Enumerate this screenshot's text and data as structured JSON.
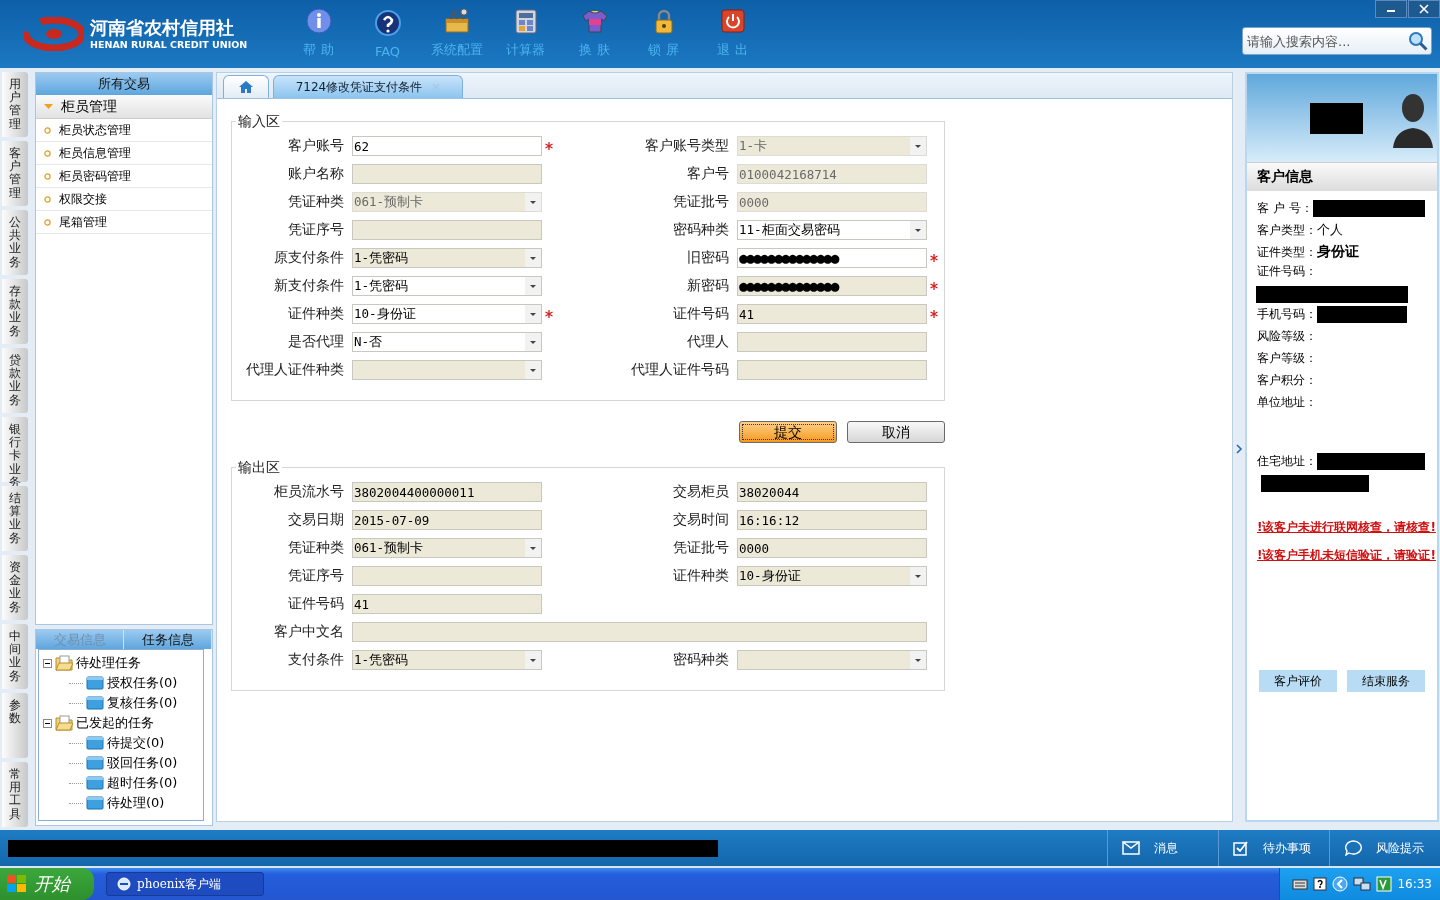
{
  "app": {
    "logo_title": "河南省农村信用社",
    "logo_subtitle": "HENAN RURAL CREDIT UNION"
  },
  "toolbar": [
    {
      "label": "帮 助",
      "kind": "help"
    },
    {
      "label": "FAQ",
      "kind": "faq"
    },
    {
      "label": "系统配置",
      "kind": "config"
    },
    {
      "label": "计算器",
      "kind": "calculator"
    },
    {
      "label": "换 肤",
      "kind": "skin"
    },
    {
      "label": "锁 屏",
      "kind": "lock"
    },
    {
      "label": "退 出",
      "kind": "exit"
    }
  ],
  "search": {
    "placeholder": "请输入搜索内容..."
  },
  "side_tabs": [
    {
      "label": "用户管理"
    },
    {
      "label": "客户管理"
    },
    {
      "label": "公共业务"
    },
    {
      "label": "存款业务"
    },
    {
      "label": "贷款业务"
    },
    {
      "label": "银行卡业务"
    },
    {
      "label": "结算业务"
    },
    {
      "label": "资金业务"
    },
    {
      "label": "中间业务"
    },
    {
      "label": "参数"
    },
    {
      "label": "常用工具"
    }
  ],
  "nav": {
    "title": "所有交易",
    "group": {
      "label": "柜员管理",
      "expanded": true,
      "items": [
        {
          "label": "柜员状态管理"
        },
        {
          "label": "柜员信息管理"
        },
        {
          "label": "柜员密码管理"
        },
        {
          "label": "权限交接"
        },
        {
          "label": "尾箱管理"
        }
      ]
    }
  },
  "task_panel": {
    "tabs": [
      {
        "label": "交易信息",
        "selected": false
      },
      {
        "label": "任务信息",
        "selected": true
      }
    ],
    "tree": [
      {
        "label": "待处理任务",
        "expanded": true,
        "children": [
          {
            "label": "授权任务(0)"
          },
          {
            "label": "复核任务(0)"
          }
        ]
      },
      {
        "label": "已发起的任务",
        "expanded": true,
        "children": [
          {
            "label": "待提交(0)"
          },
          {
            "label": "驳回任务(0)"
          },
          {
            "label": "超时任务(0)"
          },
          {
            "label": "待处理(0)"
          }
        ]
      }
    ]
  },
  "tabs": [
    {
      "kind": "home",
      "selected": false
    },
    {
      "kind": "page",
      "label": "7124修改凭证支付条件",
      "selected": true,
      "closable": true
    }
  ],
  "input_section": {
    "title": "输入区",
    "fields": [
      {
        "label": "客户账号",
        "value": "62",
        "kind": "text",
        "editable": true,
        "disabled": false,
        "required": true
      },
      {
        "label": "客户账号类型",
        "value": "1-卡",
        "kind": "select",
        "editable": false,
        "disabled": true,
        "required": false
      },
      {
        "label": "账户名称",
        "kind": "text",
        "editable": false,
        "disabled": false,
        "required": false
      },
      {
        "label": "客户号",
        "value": "0100042168714",
        "kind": "text",
        "editable": false,
        "disabled": true,
        "required": false
      },
      {
        "label": "凭证种类",
        "value": "061-预制卡",
        "kind": "select",
        "editable": false,
        "disabled": true,
        "required": false
      },
      {
        "label": "凭证批号",
        "value": "0000",
        "kind": "text",
        "editable": false,
        "disabled": true,
        "required": false
      },
      {
        "label": "凭证序号",
        "kind": "text",
        "editable": false,
        "disabled": false,
        "required": false
      },
      {
        "label": "密码种类",
        "value": "11-柜面交易密码",
        "kind": "select",
        "editable": true,
        "disabled": false,
        "required": false
      },
      {
        "label": "原支付条件",
        "value": "1-凭密码",
        "kind": "select",
        "editable": false,
        "disabled": false,
        "required": false
      },
      {
        "label": "旧密码",
        "value": "●●●●●●●●●●●●●●",
        "kind": "password",
        "editable": true,
        "disabled": false,
        "required": true
      },
      {
        "label": "新支付条件",
        "value": "1-凭密码",
        "kind": "select",
        "editable": true,
        "disabled": false,
        "required": false
      },
      {
        "label": "新密码",
        "value": "●●●●●●●●●●●●●●",
        "kind": "password",
        "editable": false,
        "disabled": false,
        "required": true
      },
      {
        "label": "证件种类",
        "value": "10-身份证",
        "kind": "select",
        "editable": true,
        "disabled": false,
        "required": true
      },
      {
        "label": "证件号码",
        "value": "41",
        "kind": "text",
        "editable": false,
        "disabled": false,
        "required": true
      },
      {
        "label": "是否代理",
        "value": "N-否",
        "kind": "select",
        "editable": true,
        "disabled": false,
        "required": false
      },
      {
        "label": "代理人",
        "kind": "text",
        "editable": false,
        "disabled": false,
        "required": false
      },
      {
        "label": "代理人证件种类",
        "kind": "select",
        "editable": false,
        "disabled": false,
        "required": false
      },
      {
        "label": "代理人证件号码",
        "kind": "text",
        "editable": false,
        "disabled": false,
        "required": false
      }
    ]
  },
  "buttons": [
    {
      "label": "提交",
      "kind": "primary"
    },
    {
      "label": "取消",
      "kind": "normal"
    }
  ],
  "output_section": {
    "title": "输出区",
    "fields": [
      {
        "label": "柜员流水号",
        "value": "3802004400000011",
        "kind": "text",
        "editable": false,
        "disabled": false,
        "required": false
      },
      {
        "label": "交易柜员",
        "value": "38020044",
        "kind": "text",
        "editable": false,
        "disabled": false,
        "required": false
      },
      {
        "label": "交易日期",
        "value": "2015-07-09",
        "kind": "text",
        "editable": false,
        "disabled": false,
        "required": false
      },
      {
        "label": "交易时间",
        "value": "16:16:12",
        "kind": "text",
        "editable": false,
        "disabled": false,
        "required": false
      },
      {
        "label": "凭证种类",
        "value": "061-预制卡",
        "kind": "select",
        "editable": false,
        "disabled": false,
        "required": false
      },
      {
        "label": "凭证批号",
        "value": "0000",
        "kind": "text",
        "editable": false,
        "disabled": false,
        "required": false
      },
      {
        "label": "凭证序号",
        "kind": "text",
        "editable": false,
        "disabled": false,
        "required": false
      },
      {
        "label": "证件种类",
        "value": "10-身份证",
        "kind": "select",
        "editable": false,
        "disabled": false,
        "required": false
      },
      {
        "label": "证件号码",
        "value": "41",
        "kind": "text",
        "editable": false,
        "disabled": false,
        "required": false
      },
      {
        "label": "客户中文名",
        "kind": "wide",
        "editable": false,
        "disabled": false,
        "required": false
      },
      {
        "label": "支付条件",
        "value": "1-凭密码",
        "kind": "select",
        "editable": false,
        "disabled": false,
        "required": false
      },
      {
        "label": "密码种类",
        "kind": "select",
        "editable": false,
        "disabled": false,
        "required": false
      }
    ]
  },
  "customer": {
    "title": "客户信息",
    "rows": [
      {
        "label": "客 户 号：",
        "kind": "redacted_inline"
      },
      {
        "label": "客户类型：",
        "value": "个人",
        "emphasis": false
      },
      {
        "label": "证件类型：",
        "value": "身份证",
        "emphasis": true
      },
      {
        "label": "证件号码：",
        "kind": "redacted_below"
      },
      {
        "label": "手机号码：",
        "kind": "redacted_inline"
      },
      {
        "label": "风险等级："
      },
      {
        "label": "客户等级："
      },
      {
        "label": "客户积分："
      },
      {
        "label": "单位地址："
      },
      {
        "label": "住宅地址：",
        "kind": "redacted_address"
      }
    ],
    "warnings": [
      {
        "text": "!该客户未进行联网核查，请核查!"
      },
      {
        "text": "!该客户手机未短信验证，请验证!"
      }
    ],
    "buttons": [
      {
        "label": "客户评价"
      },
      {
        "label": "结束服务"
      }
    ]
  },
  "status_bar": {
    "items": [
      {
        "label": "消息",
        "kind": "message"
      },
      {
        "label": "待办事项",
        "kind": "todo"
      },
      {
        "label": "风险提示",
        "kind": "risk"
      }
    ]
  },
  "taskbar": {
    "start": "开始",
    "tasks": [
      {
        "label": "phoenix客户端"
      }
    ],
    "clock": "16:33"
  }
}
